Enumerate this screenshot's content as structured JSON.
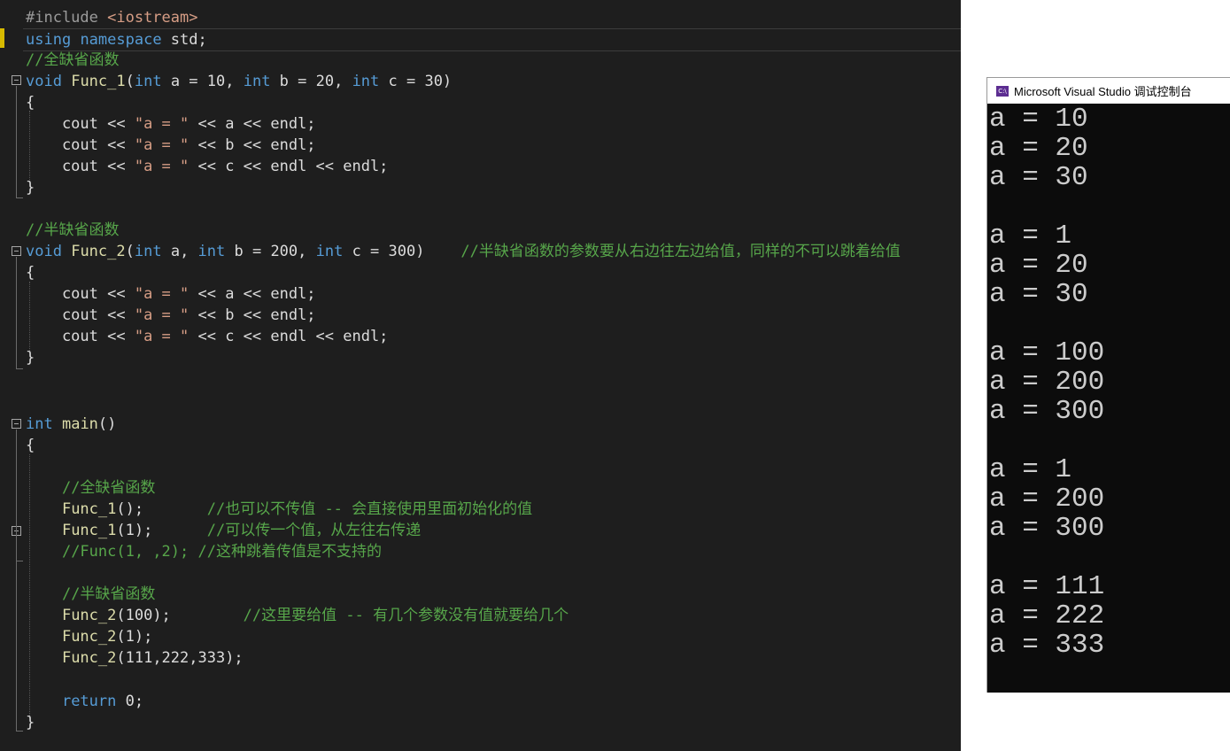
{
  "editor": {
    "lines": [
      "#include <iostream>",
      "using namespace std;",
      "//全缺省函数",
      "void Func_1(int a = 10, int b = 20, int c = 30)",
      "{",
      "    cout << \"a = \" << a << endl;",
      "    cout << \"a = \" << b << endl;",
      "    cout << \"a = \" << c << endl << endl;",
      "}",
      "",
      "//半缺省函数",
      "void Func_2(int a, int b = 200, int c = 300)    //半缺省函数的参数要从右边往左边给值，同样的不可以跳着给值",
      "{",
      "    cout << \"a = \" << a << endl;",
      "    cout << \"a = \" << b << endl;",
      "    cout << \"a = \" << c << endl << endl;",
      "}",
      "",
      "",
      "int main()",
      "{",
      "",
      "    //全缺省函数",
      "    Func_1();       //也可以不传值 -- 会直接使用里面初始化的值",
      "    Func_1(1);      //可以传一个值，从左往右传递",
      "    //Func(1, ,2); //这种跳着传值是不支持的",
      "",
      "    //半缺省函数",
      "    Func_2(100);        //这里要给值 -- 有几个参数没有值就要给几个",
      "    Func_2(1);",
      "    Func_2(111,222,333);",
      "",
      "    return 0;",
      "}"
    ]
  },
  "console": {
    "title": "Microsoft Visual Studio 调试控制台",
    "icon": "visual-studio-console-icon",
    "output": [
      "a = 10",
      "a = 20",
      "a = 30",
      "",
      "a = 1",
      "a = 20",
      "a = 30",
      "",
      "a = 100",
      "a = 200",
      "a = 300",
      "",
      "a = 1",
      "a = 200",
      "a = 300",
      "",
      "a = 111",
      "a = 222",
      "a = 333"
    ]
  },
  "colors": {
    "editor_background": "#1e1e1e",
    "keyword": "#569cd6",
    "comment": "#57a64a",
    "string": "#d69d85",
    "console_background": "#0c0c0c"
  }
}
